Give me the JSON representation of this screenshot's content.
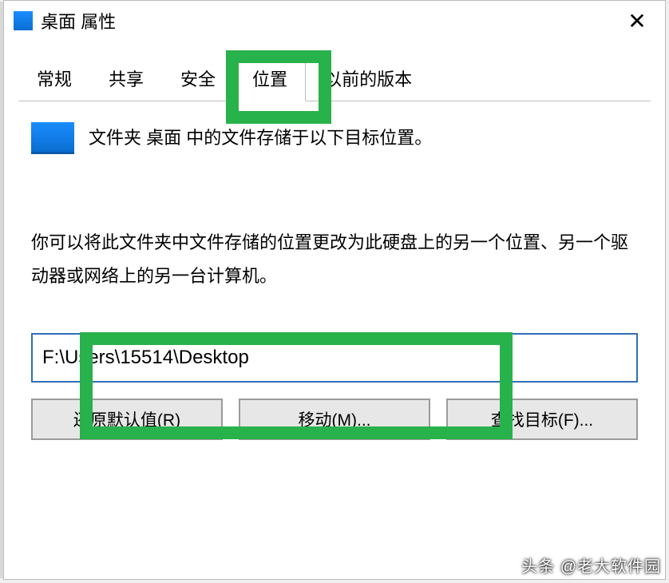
{
  "window": {
    "title": "桌面 属性"
  },
  "tabs": {
    "general": "常规",
    "sharing": "共享",
    "security": "安全",
    "location": "位置",
    "previous": "以前的版本"
  },
  "content": {
    "header": "文件夹 桌面 中的文件存储于以下目标位置。",
    "description": "你可以将此文件夹中文件存储的位置更改为此硬盘上的另一个位置、另一个驱动器或网络上的另一台计算机。",
    "path": "F:\\Users\\15514\\Desktop"
  },
  "buttons": {
    "restore": "还原默认值(R)",
    "move": "移动(M)...",
    "find": "查找目标(F)..."
  },
  "watermark": "头条 @老大软件园"
}
